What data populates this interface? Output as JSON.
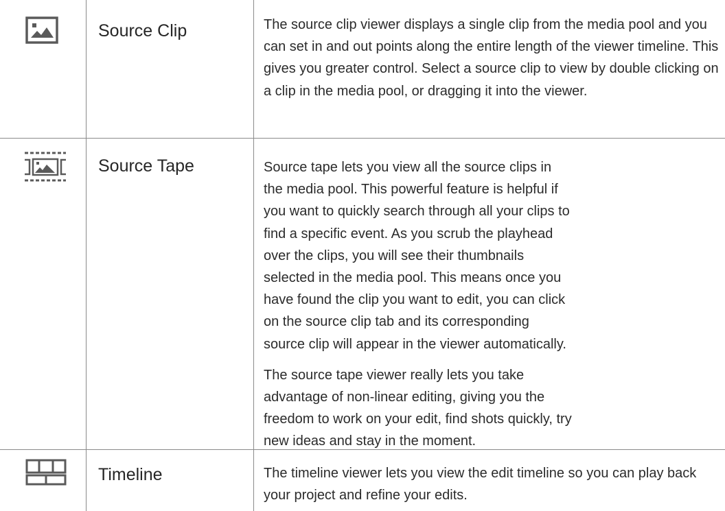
{
  "rows": [
    {
      "icon": "source-clip-icon",
      "name": "Source Clip",
      "paragraphs": [
        "The source clip viewer displays a single clip from the media pool and you can set in and out points along the entire length of the viewer timeline. This gives you greater control. Select a source clip to view by double clicking on a clip in the media pool, or dragging it into the viewer."
      ]
    },
    {
      "icon": "source-tape-icon",
      "name": "Source Tape",
      "paragraphs": [
        "Source tape lets you view all the source clips in the media pool. This powerful feature is helpful if you want to quickly search through all your clips to find a specific event. As you scrub the playhead over the clips, you will see their thumbnails selected in the media pool. This means once you have found the clip you want to edit, you can click on the source clip tab and its corresponding source clip will appear in the viewer automatically.",
        "The source tape viewer really lets you take advantage of non-linear editing, giving you the freedom to work on your edit, find shots quickly, try new ideas and stay in the moment."
      ]
    },
    {
      "icon": "timeline-icon",
      "name": "Timeline",
      "paragraphs": [
        "The timeline viewer lets you view the edit timeline so you can play back your project and refine your edits."
      ]
    }
  ]
}
